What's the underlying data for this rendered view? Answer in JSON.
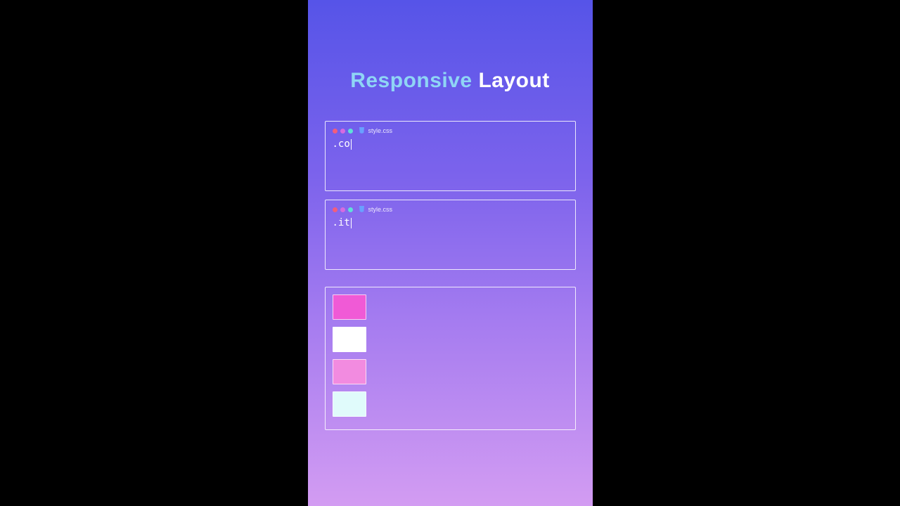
{
  "title": {
    "accent": "Responsive",
    "main": "Layout"
  },
  "cards": [
    {
      "file": "style.css",
      "code": ".co"
    },
    {
      "file": "style.css",
      "code": ".it"
    }
  ],
  "preview": {
    "items": [
      {
        "colorClass": "c-magenta"
      },
      {
        "colorClass": "c-white"
      },
      {
        "colorClass": "c-pink"
      },
      {
        "colorClass": "c-mint"
      }
    ]
  },
  "colors": {
    "gradientTop": "#5654e8",
    "gradientBottom": "#d39cf2",
    "accentText": "#8fd5f5"
  }
}
